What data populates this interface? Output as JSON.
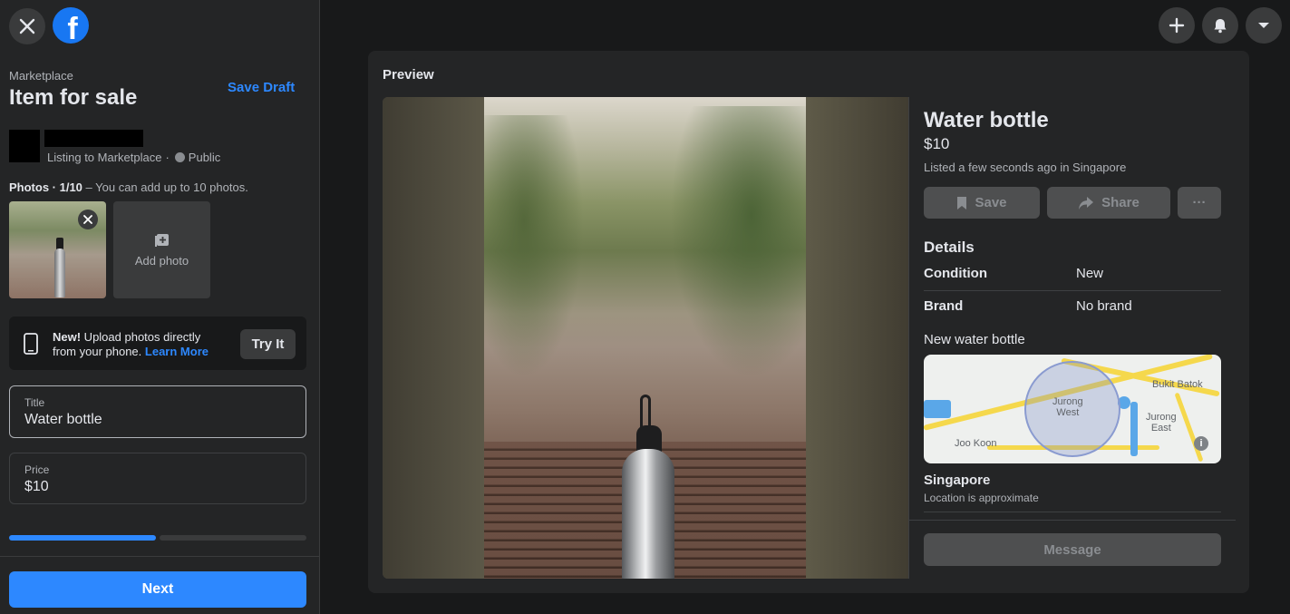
{
  "header": {
    "logo_letter": "f"
  },
  "sidebar": {
    "breadcrumb": "Marketplace",
    "title": "Item for sale",
    "save_draft": "Save Draft",
    "listing_to": "Listing to Marketplace",
    "separator": "·",
    "visibility": "Public",
    "photos_label_bold": "Photos · 1/10",
    "photos_label_rest": " – You can add up to 10 photos.",
    "add_photo": "Add photo",
    "upload_new": "New!",
    "upload_text_1": " Upload photos directly",
    "upload_text_2": "from your phone.",
    "learn_more": "Learn More",
    "try_it": "Try It",
    "title_field": {
      "label": "Title",
      "value": "Water bottle"
    },
    "price_field": {
      "label": "Price",
      "value": "$10"
    },
    "next": "Next"
  },
  "preview": {
    "heading": "Preview",
    "item_title": "Water bottle",
    "price": "$10",
    "listed": "Listed a few seconds ago in Singapore",
    "save": "Save",
    "share": "Share",
    "more": "···",
    "details_heading": "Details",
    "details": [
      {
        "key": "Condition",
        "value": "New"
      },
      {
        "key": "Brand",
        "value": "No brand"
      }
    ],
    "description": "New water bottle",
    "map_labels": {
      "jurong_west": "Jurong\nWest",
      "bukit_batok": "Bukit Batok",
      "jurong_east": "Jurong\nEast",
      "joo_koon": "Joo Koon"
    },
    "location": "Singapore",
    "location_note": "Location is approximate",
    "message": "Message"
  },
  "colors": {
    "accent": "#2d88ff",
    "background": "#18191a",
    "panel": "#242526",
    "fb_blue": "#1877f2"
  },
  "icons": [
    "close-icon",
    "facebook-logo",
    "globe-icon",
    "remove-photo-icon",
    "add-photo-icon",
    "phone-icon",
    "plus-icon",
    "bell-icon",
    "caret-down-icon",
    "bookmark-icon",
    "share-icon",
    "info-icon"
  ],
  "progress": {
    "step": 1,
    "total": 2
  }
}
